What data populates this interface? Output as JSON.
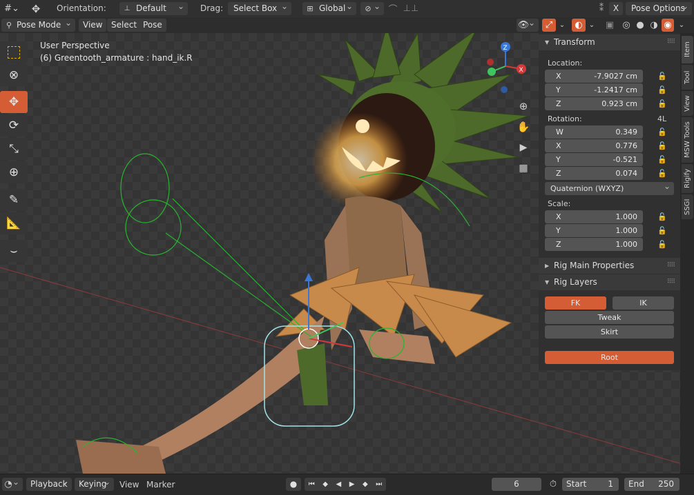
{
  "header": {
    "orientation_label": "Orientation:",
    "orientation_value": "Default",
    "drag_label": "Drag:",
    "drag_value": "Select Box",
    "transform_value": "Global",
    "x_mirror": "X",
    "pose_options": "Pose Options"
  },
  "modebar": {
    "mode": "Pose Mode",
    "menus": [
      "View",
      "Select",
      "Pose"
    ]
  },
  "viewport": {
    "perspective": "User Perspective",
    "active_object": "(6) Greentooth_armature : hand_ik.R",
    "gizmo": {
      "x": "X",
      "y": "Y",
      "z": "Z"
    },
    "accent_color": "#d55d35"
  },
  "toolbar": {
    "tools": [
      "select-box-icon",
      "cursor-icon",
      "move-icon",
      "rotate-icon",
      "scale-icon",
      "transform-icon",
      "annotate-icon",
      "measure-icon",
      "relax-icon"
    ],
    "active_tool": "move-icon"
  },
  "sidebar": {
    "tabs": [
      "Item",
      "Tool",
      "View",
      "MSW Tools",
      "Rigify",
      "SSGI"
    ],
    "active_tab": "Item",
    "transform": {
      "title": "Transform",
      "location_label": "Location:",
      "location": [
        {
          "axis": "X",
          "value": "-7.9027 cm"
        },
        {
          "axis": "Y",
          "value": "-1.2417 cm"
        },
        {
          "axis": "Z",
          "value": "0.923 cm"
        }
      ],
      "rotation_label": "Rotation:",
      "rotation_lock_label": "4L",
      "rotation": [
        {
          "axis": "W",
          "value": "0.349"
        },
        {
          "axis": "X",
          "value": "0.776"
        },
        {
          "axis": "Y",
          "value": "-0.521"
        },
        {
          "axis": "Z",
          "value": "0.074"
        }
      ],
      "rotation_mode": "Quaternion (WXYZ)",
      "scale_label": "Scale:",
      "scale": [
        {
          "axis": "X",
          "value": "1.000"
        },
        {
          "axis": "Y",
          "value": "1.000"
        },
        {
          "axis": "Z",
          "value": "1.000"
        }
      ]
    },
    "rig_main": {
      "title": "Rig Main Properties"
    },
    "rig_layers": {
      "title": "Rig Layers",
      "fk": "FK",
      "ik": "IK",
      "tweak": "Tweak",
      "skirt": "Skirt",
      "root": "Root"
    }
  },
  "timeline": {
    "playback": "Playback",
    "keying": "Keying",
    "view": "View",
    "marker": "Marker",
    "current_frame": "6",
    "start_label": "Start",
    "start": "1",
    "end_label": "End",
    "end": "250"
  }
}
